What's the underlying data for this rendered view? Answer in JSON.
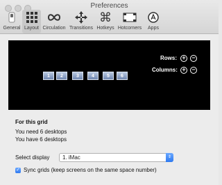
{
  "window": {
    "title": "Preferences"
  },
  "toolbar": {
    "items": [
      {
        "label": "General"
      },
      {
        "label": "Layout"
      },
      {
        "label": "Circulation"
      },
      {
        "label": "Transitions"
      },
      {
        "label": "Hotkeys"
      },
      {
        "label": "Hotcorners"
      },
      {
        "label": "Apps"
      }
    ],
    "selected": "Layout"
  },
  "grid": {
    "desktops": [
      "1",
      "2",
      "3",
      "4",
      "5",
      "6"
    ],
    "rows_label": "Rows:",
    "columns_label": "Columns:",
    "plus": "+",
    "minus": "−"
  },
  "info": {
    "heading": "For this grid",
    "need": "You need 6 desktops",
    "have": "You have 6 desktops"
  },
  "display": {
    "label": "Select display",
    "value": "1. iMac"
  },
  "sync": {
    "checked": true,
    "label": "Sync grids (keep screens on the same space number)"
  },
  "colors": {
    "accent": "#2f7af0",
    "desktop_fill": "#7f94bb",
    "grid_bg": "#000000"
  }
}
